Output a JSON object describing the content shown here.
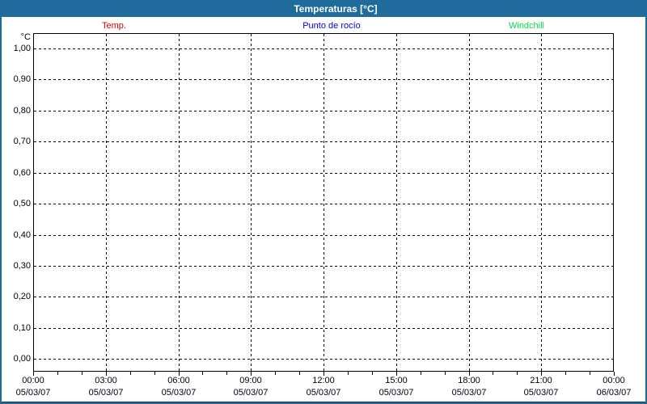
{
  "window": {
    "title": "Temperaturas [°C]",
    "frame_color": "#1e6b9c",
    "title_text_color": "#ffffff"
  },
  "chart_data": {
    "type": "line",
    "title": "Temperaturas [°C]",
    "ylabel": "°C",
    "xlabel": "",
    "ylim": [
      0.0,
      1.0
    ],
    "y_tick_labels": [
      "1,00",
      "0,90",
      "0,80",
      "0,70",
      "0,60",
      "0,50",
      "0,40",
      "0,30",
      "0,20",
      "0,10",
      "0,00"
    ],
    "x_axis": {
      "range_hours": 24,
      "major_interval_hours": 3,
      "minor_interval_hours": 1,
      "ticks": [
        {
          "time": "00:00",
          "date": "05/03/07"
        },
        {
          "time": "03:00",
          "date": "05/03/07"
        },
        {
          "time": "06:00",
          "date": "05/03/07"
        },
        {
          "time": "09:00",
          "date": "05/03/07"
        },
        {
          "time": "12:00",
          "date": "05/03/07"
        },
        {
          "time": "15:00",
          "date": "05/03/07"
        },
        {
          "time": "18:00",
          "date": "05/03/07"
        },
        {
          "time": "21:00",
          "date": "05/03/07"
        },
        {
          "time": "00:00",
          "date": "06/03/07"
        }
      ]
    },
    "grid": "dashed",
    "grid_color": "#000000",
    "legend_position": "top",
    "series": [
      {
        "name": "Temp.",
        "color": "#e10000",
        "values": []
      },
      {
        "name": "Punto de rocío",
        "color": "#0000dc",
        "values": []
      },
      {
        "name": "Windchill",
        "color": "#00dd44",
        "values": []
      }
    ]
  }
}
